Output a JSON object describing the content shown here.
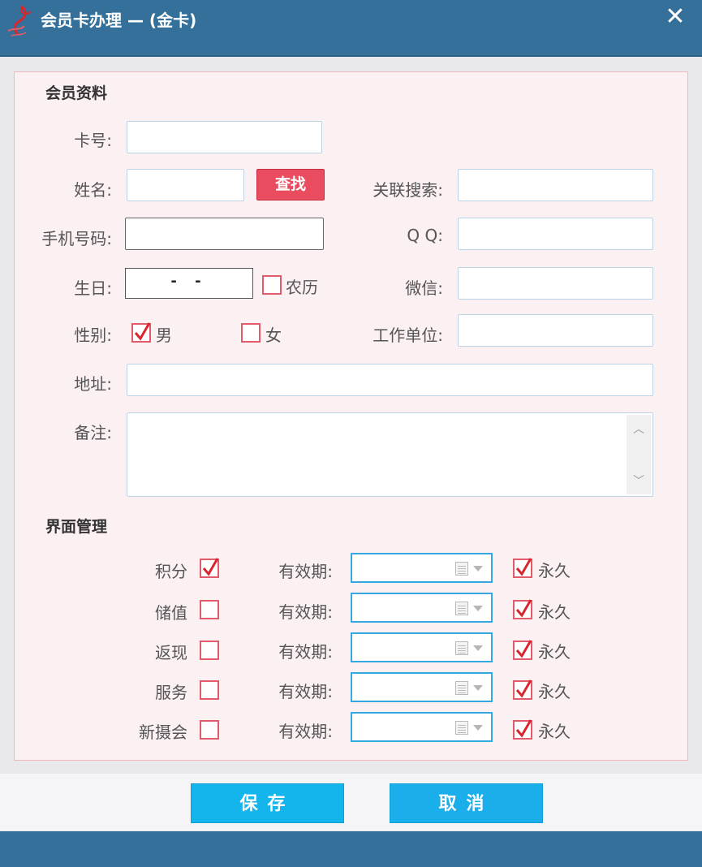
{
  "window": {
    "title": "会员卡办理 — (金卡)",
    "close_icon": "close-icon"
  },
  "member_info": {
    "section_title": "会员资料",
    "card_no_label": "卡号:",
    "card_no_value": "",
    "name_label": "姓名:",
    "name_value": "",
    "find_button": "查找",
    "related_search_label": "关联搜索:",
    "related_search_value": "",
    "phone_label": "手机号码:",
    "phone_value": "",
    "qq_label": "Q Q:",
    "qq_value": "",
    "birthday_label": "生日:",
    "birthday_value": "- -",
    "lunar_label": "农历",
    "lunar_checked": false,
    "wechat_label": "微信:",
    "wechat_value": "",
    "gender_label": "性别:",
    "male_label": "男",
    "male_checked": true,
    "female_label": "女",
    "female_checked": false,
    "work_unit_label": "工作单位:",
    "work_unit_value": "",
    "address_label": "地址:",
    "address_value": "",
    "remark_label": "备注:",
    "remark_value": ""
  },
  "interface_mgmt": {
    "section_title": "界面管理",
    "rows": [
      {
        "name": "积分",
        "checked": true,
        "validity_label": "有效期:",
        "validity_value": "",
        "permanent_label": "永久",
        "permanent_checked": true
      },
      {
        "name": "储值",
        "checked": false,
        "validity_label": "有效期:",
        "validity_value": "",
        "permanent_label": "永久",
        "permanent_checked": true
      },
      {
        "name": "返现",
        "checked": false,
        "validity_label": "有效期:",
        "validity_value": "",
        "permanent_label": "永久",
        "permanent_checked": true
      },
      {
        "name": "服务",
        "checked": false,
        "validity_label": "有效期:",
        "validity_value": "",
        "permanent_label": "永久",
        "permanent_checked": true
      },
      {
        "name": "新摄会",
        "checked": false,
        "validity_label": "有效期:",
        "validity_value": "",
        "permanent_label": "永久",
        "permanent_checked": true
      }
    ]
  },
  "footer": {
    "save_button": "保存",
    "cancel_button": "取消"
  },
  "colors": {
    "titlebar": "#34709a",
    "panel_bg": "#fbf0f2",
    "accent_red": "#e94b5f",
    "primary_blue": "#14b4ec"
  }
}
